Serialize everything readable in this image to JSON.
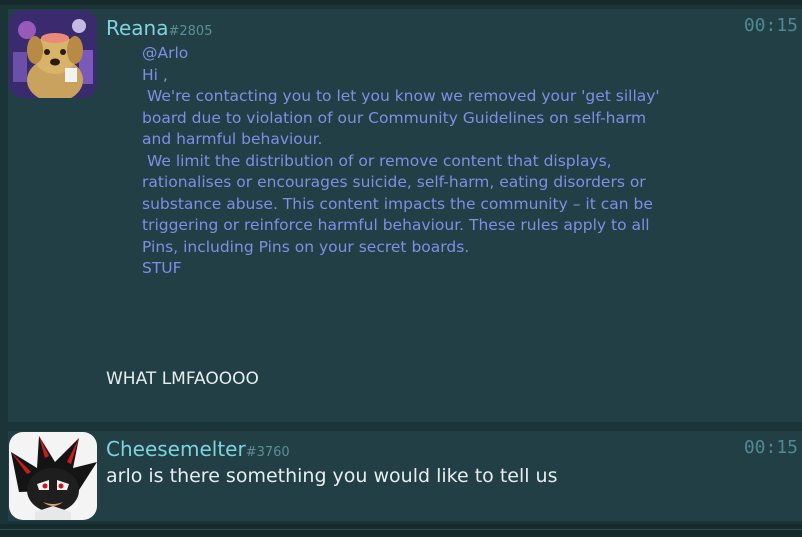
{
  "messages": [
    {
      "username": "Reana",
      "discriminator": "#2805",
      "time": "00:15",
      "avatar_icon": "dog-avatar-icon",
      "quote_lines": [
        "@Arlo",
        "",
        "Hi ,",
        " We're contacting you to let you know we removed your 'get sillay'",
        "board due to violation of our Community Guidelines on self-harm",
        "and harmful behaviour.",
        " We limit the distribution of or remove content that displays,",
        "rationalises or encourages suicide, self-harm, eating disorders or",
        "substance abuse. This content impacts the community – it can be",
        "triggering or reinforce harmful behaviour. These rules apply to all",
        "Pins, including Pins on your secret boards.",
        "",
        "STUF"
      ],
      "reply": "WHAT LMFAOOOO"
    },
    {
      "username": "Cheesemelter",
      "discriminator": "#3760",
      "time": "00:15",
      "avatar_icon": "shadow-hedgehog-avatar-icon",
      "text": "arlo is there something you would like to tell us"
    }
  ],
  "colors": {
    "background": "#1b3437",
    "message_bg": "#213f44",
    "username": "#7fd3e0",
    "quote_text": "#7f8fe6",
    "body_text": "#e6eef0",
    "timestamp": "#4f8a93"
  }
}
